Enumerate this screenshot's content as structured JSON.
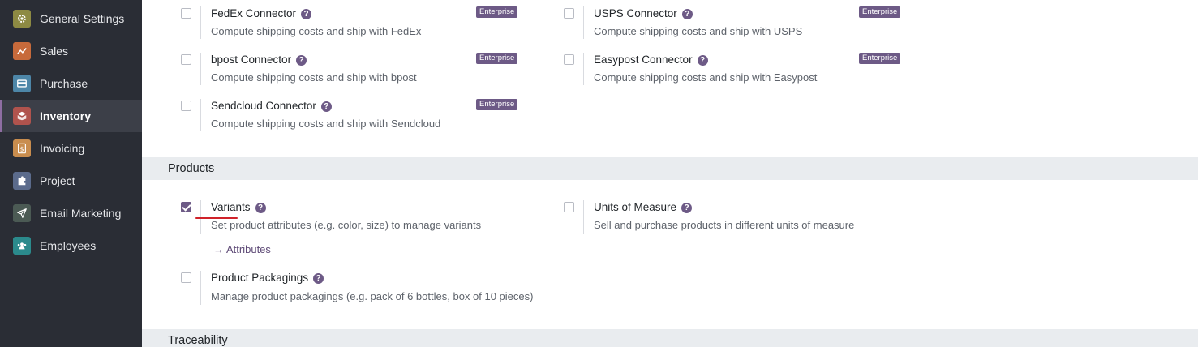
{
  "sidebar": {
    "items": [
      {
        "label": "General Settings",
        "icon": "gear-icon",
        "color": "#8d8a43"
      },
      {
        "label": "Sales",
        "icon": "chart-icon",
        "color": "#c76a3b"
      },
      {
        "label": "Purchase",
        "icon": "card-icon",
        "color": "#4d86a8"
      },
      {
        "label": "Inventory",
        "icon": "box-icon",
        "color": "#b0534d",
        "active": true
      },
      {
        "label": "Invoicing",
        "icon": "dollar-icon",
        "color": "#c98d4e"
      },
      {
        "label": "Project",
        "icon": "puzzle-icon",
        "color": "#5b6b8c"
      },
      {
        "label": "Email Marketing",
        "icon": "paper-plane-icon",
        "color": "#4b5a54"
      },
      {
        "label": "Employees",
        "icon": "people-icon",
        "color": "#2b8a8c"
      }
    ]
  },
  "shipping": {
    "badge": "Enterprise",
    "connectors": [
      {
        "title": "FedEx Connector",
        "desc": "Compute shipping costs and ship with FedEx",
        "checked": false
      },
      {
        "title": "USPS Connector",
        "desc": "Compute shipping costs and ship with USPS",
        "checked": false
      },
      {
        "title": "bpost Connector",
        "desc": "Compute shipping costs and ship with bpost",
        "checked": false
      },
      {
        "title": "Easypost Connector",
        "desc": "Compute shipping costs and ship with Easypost",
        "checked": false
      },
      {
        "title": "Sendcloud Connector",
        "desc": "Compute shipping costs and ship with Sendcloud",
        "checked": false
      }
    ]
  },
  "products": {
    "heading": "Products",
    "variants": {
      "title": "Variants",
      "desc": "Set product attributes (e.g. color, size) to manage variants",
      "checked": true,
      "link": "Attributes"
    },
    "uom": {
      "title": "Units of Measure",
      "desc": "Sell and purchase products in different units of measure",
      "checked": false
    },
    "packagings": {
      "title": "Product Packagings",
      "desc": "Manage product packagings (e.g. pack of 6 bottles, box of 10 pieces)",
      "checked": false
    }
  },
  "traceability": {
    "heading": "Traceability"
  },
  "help_glyph": "?",
  "arrow_glyph": "→"
}
